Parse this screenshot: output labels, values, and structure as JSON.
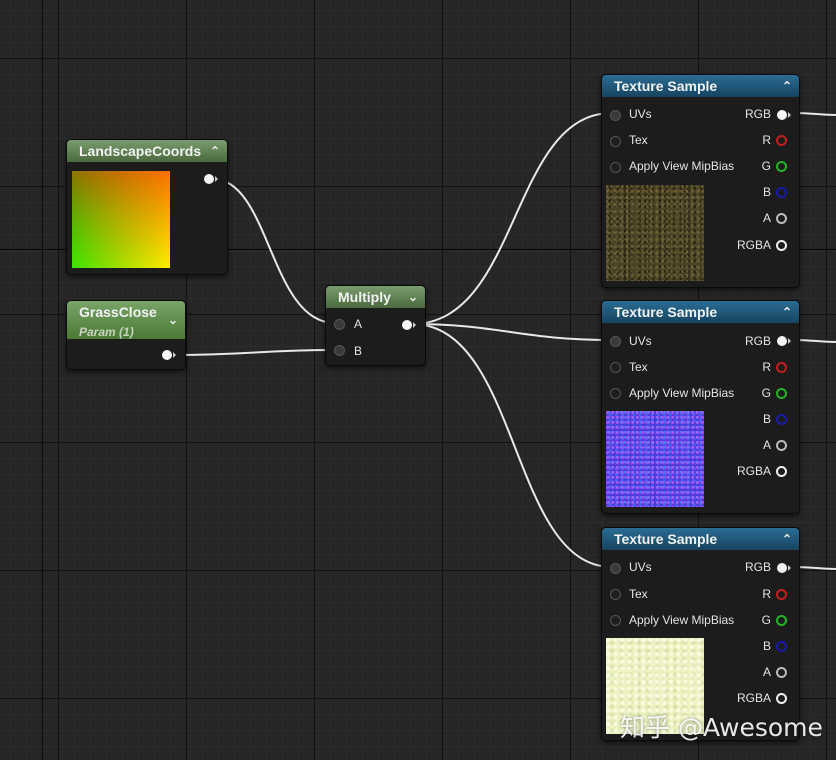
{
  "nodes": {
    "landscape_coords": {
      "title": "LandscapeCoords"
    },
    "grass_close": {
      "title": "GrassClose",
      "subtitle": "Param (1)"
    },
    "multiply": {
      "title": "Multiply",
      "input_a": "A",
      "input_b": "B"
    },
    "texture_samples": [
      {
        "title": "Texture Sample",
        "inputs": [
          "UVs",
          "Tex",
          "Apply View MipBias"
        ],
        "outputs": [
          "RGB",
          "R",
          "G",
          "B",
          "A",
          "RGBA"
        ],
        "preview": "dirt-ground"
      },
      {
        "title": "Texture Sample",
        "inputs": [
          "UVs",
          "Tex",
          "Apply View MipBias"
        ],
        "outputs": [
          "RGB",
          "R",
          "G",
          "B",
          "A",
          "RGBA"
        ],
        "preview": "normal-map"
      },
      {
        "title": "Texture Sample",
        "inputs": [
          "UVs",
          "Tex",
          "Apply View MipBias"
        ],
        "outputs": [
          "RGB",
          "R",
          "G",
          "B",
          "A",
          "RGBA"
        ],
        "preview": "pale-yellow"
      }
    ]
  },
  "pin_colors": {
    "R": "#c41e1e",
    "G": "#27b327",
    "B": "#1a1aa8",
    "A": "#bbbbbb",
    "RGBA": "#f0f0f0",
    "RGB": "#f4f4f4"
  },
  "icons": {
    "collapse": "chevron-up-icon",
    "expand": "chevron-down-icon"
  },
  "watermark": "知乎 @Awesome"
}
